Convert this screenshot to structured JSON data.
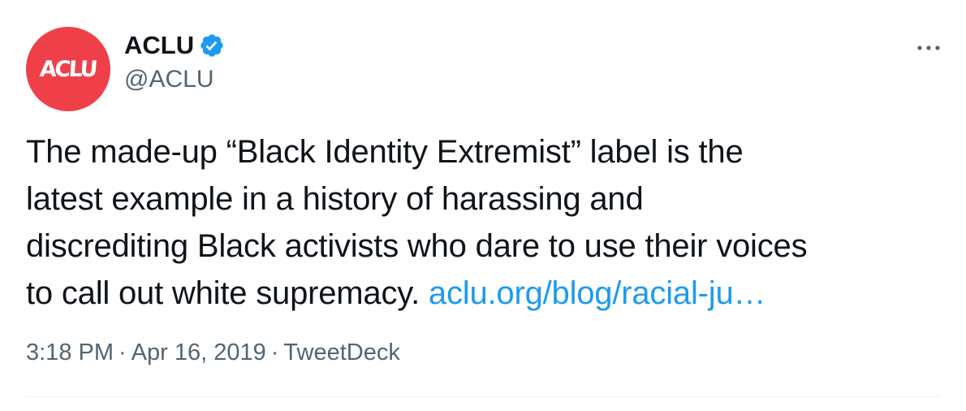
{
  "author": {
    "avatar_text": "ACLU",
    "display_name": "ACLU",
    "handle": "@ACLU",
    "verified": true,
    "avatar_color": "#ef404a",
    "verified_color": "#1d9bf0"
  },
  "menu": {
    "more_icon": "···"
  },
  "tweet": {
    "lines": [
      "The made-up “Black Identity Extremist” label is the",
      "latest example in a history of harassing and",
      "discrediting Black activists who dare to use their voices",
      "to call out white supremacy. "
    ],
    "link_text": "aclu.org/blog/racial-ju…",
    "link_color": "#1d9bf0"
  },
  "meta": {
    "time": "3:18 PM",
    "separator": "·",
    "date": "Apr 16, 2019",
    "source": "TweetDeck"
  }
}
